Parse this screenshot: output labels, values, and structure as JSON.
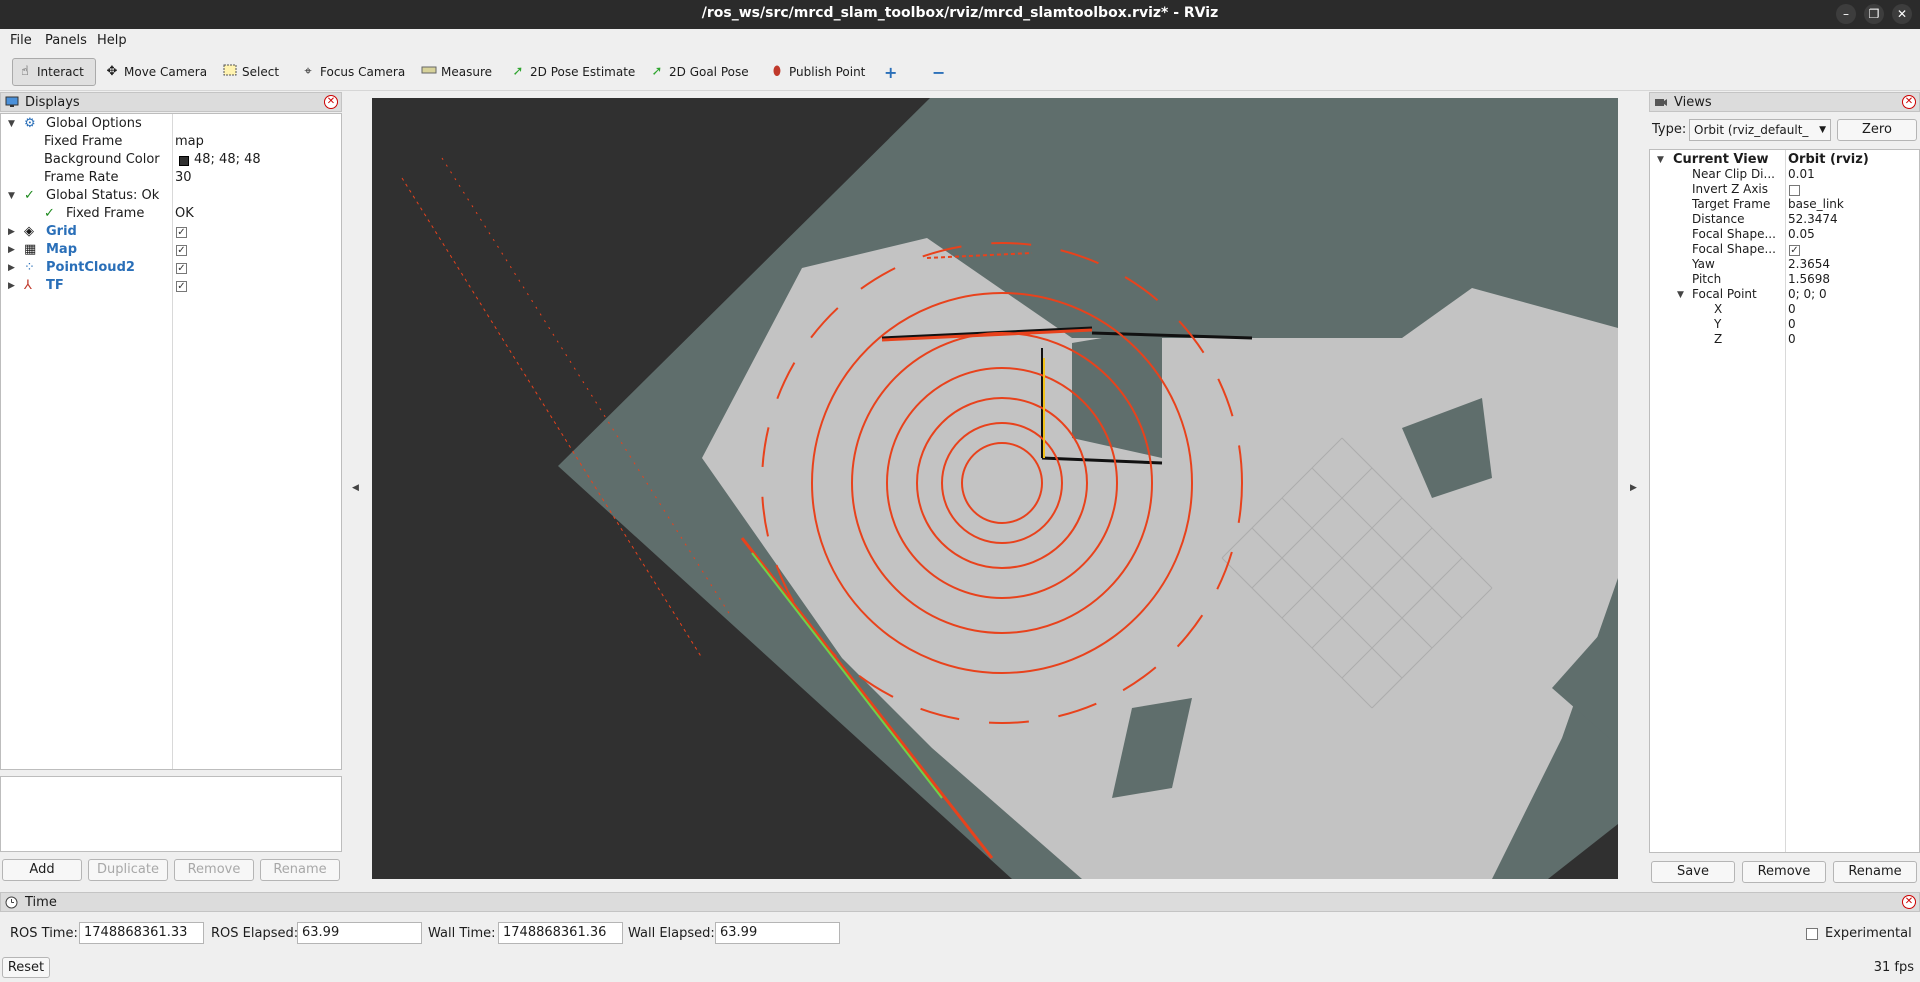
{
  "window": {
    "title": "/ros_ws/src/mrcd_slam_toolbox/rviz/mrcd_slamtoolbox.rviz* - RViz",
    "minimize": "–",
    "maximize": "❐",
    "close": "✕"
  },
  "menu": [
    "File",
    "Panels",
    "Help"
  ],
  "toolbar": {
    "interact": "Interact",
    "move_camera": "Move Camera",
    "select": "Select",
    "focus_camera": "Focus Camera",
    "measure": "Measure",
    "pose_estimate": "2D Pose Estimate",
    "goal_pose": "2D Goal Pose",
    "publish_point": "Publish Point",
    "add_tool": "+",
    "remove_tool": "−"
  },
  "displays": {
    "title": "Displays",
    "global_options": "Global Options",
    "fixed_frame_label": "Fixed Frame",
    "fixed_frame_value": "map",
    "background_color_label": "Background Color",
    "background_color_value": "48; 48; 48",
    "background_color_hex": "#303030",
    "frame_rate_label": "Frame Rate",
    "frame_rate_value": "30",
    "global_status": "Global Status: Ok",
    "status_fixed_frame_label": "Fixed Frame",
    "status_fixed_frame_value": "OK",
    "items": [
      {
        "name": "Grid",
        "checked": true,
        "icon": "grid-icon"
      },
      {
        "name": "Map",
        "checked": true,
        "icon": "map-icon"
      },
      {
        "name": "PointCloud2",
        "checked": true,
        "icon": "pointcloud-icon"
      },
      {
        "name": "TF",
        "checked": true,
        "icon": "tf-icon"
      }
    ],
    "buttons": {
      "add": "Add",
      "duplicate": "Duplicate",
      "remove": "Remove",
      "rename": "Rename"
    }
  },
  "views": {
    "title": "Views",
    "type_label": "Type:",
    "type_value": "Orbit (rviz_default_",
    "zero": "Zero",
    "current_view": "Current View",
    "current_view_value": "Orbit (rviz)",
    "props": [
      {
        "label": "Near Clip Di...",
        "value": "0.01"
      },
      {
        "label": "Invert Z Axis",
        "value": ""
      },
      {
        "label": "Target Frame",
        "value": "base_link"
      },
      {
        "label": "Distance",
        "value": "52.3474"
      },
      {
        "label": "Focal Shape...",
        "value": "0.05"
      },
      {
        "label": "Focal Shape...",
        "value": ""
      },
      {
        "label": "Yaw",
        "value": "2.3654"
      },
      {
        "label": "Pitch",
        "value": "1.5698"
      },
      {
        "label": "Focal Point",
        "value": "0; 0; 0"
      },
      {
        "label": "X",
        "value": "0"
      },
      {
        "label": "Y",
        "value": "0"
      },
      {
        "label": "Z",
        "value": "0"
      }
    ],
    "buttons": {
      "save": "Save",
      "remove": "Remove",
      "rename": "Rename"
    }
  },
  "time": {
    "title": "Time",
    "ros_time_label": "ROS Time:",
    "ros_time": "1748868361.33",
    "ros_elapsed_label": "ROS Elapsed:",
    "ros_elapsed": "63.99",
    "wall_time_label": "Wall Time:",
    "wall_time": "1748868361.36",
    "wall_elapsed_label": "Wall Elapsed:",
    "wall_elapsed": "63.99",
    "experimental": "Experimental",
    "reset": "Reset",
    "fps": "31 fps"
  },
  "colors": {
    "map_free": "#c6c6c6",
    "map_unknown": "#5f6e6c",
    "scan": "#e8421c",
    "accent_blue": "#2a6fb8"
  }
}
